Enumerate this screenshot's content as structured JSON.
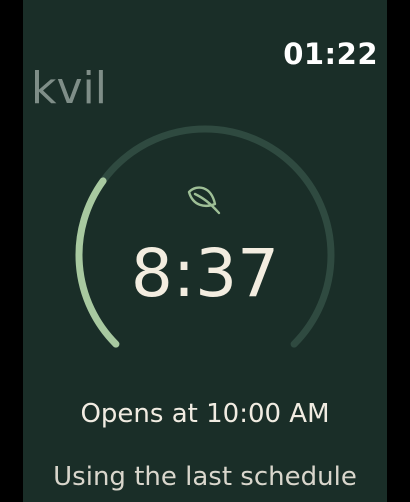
{
  "status_bar": {
    "time": "01:22"
  },
  "app": {
    "name": "kvil"
  },
  "timer": {
    "value": "8:37",
    "icon": "leaf-icon",
    "progress_fraction": 0.3
  },
  "schedule": {
    "opens_label": "Opens at",
    "opens_time": "10:00 AM",
    "note": "Using the last schedule"
  },
  "colors": {
    "background": "#1a2e28",
    "ring_track": "#2f4a40",
    "ring_progress": "#a8c9a0",
    "icon": "#9ebf96"
  }
}
